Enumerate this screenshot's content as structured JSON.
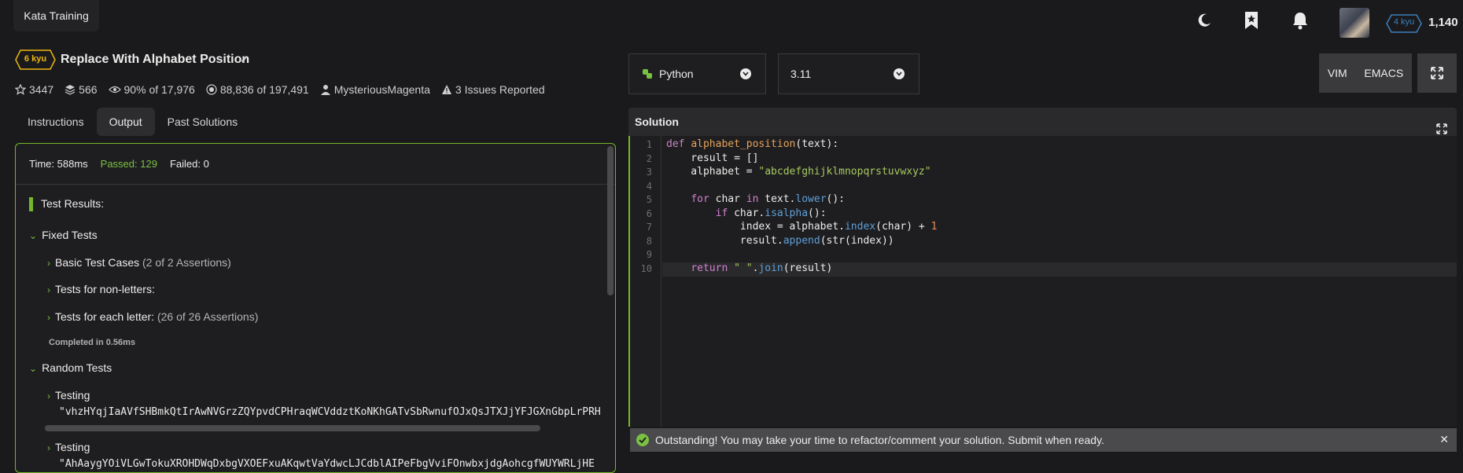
{
  "app": {
    "brand": "Kata Training"
  },
  "user": {
    "rank": "4 kyu",
    "honor": "1,140"
  },
  "colors": {
    "accent_green": "#75b72b",
    "kyu_yellow": "#ecb613",
    "rank_blue": "#3c7ebb"
  },
  "kata": {
    "kyu": "6 kyu",
    "title": "Replace With Alphabet Position",
    "stars": "3447",
    "collections": "566",
    "satisfaction": "90%",
    "satisfaction_of": "of 17,976",
    "completed": "88,836",
    "completed_of": "of 197,491",
    "author": "MysteriousMagenta",
    "issues": "3 Issues Reported"
  },
  "tabs": [
    "Instructions",
    "Output",
    "Past Solutions"
  ],
  "output": {
    "time": "Time: 588ms",
    "passed": "Passed: 129",
    "failed": "Failed: 0",
    "results_title": "Test Results:",
    "fixed_tests": "Fixed Tests",
    "basic_cases": "Basic Test Cases",
    "basic_cases_count": "(2 of 2 Assertions)",
    "non_letters": "Tests for non-letters:",
    "each_letter": "Tests for each letter:",
    "each_letter_count": "(26 of 26 Assertions)",
    "completed_in": "Completed in 0.56ms",
    "random_tests": "Random Tests",
    "testing_label": "Testing",
    "testing_1": "\"vhzHYqjIaAVfSHBmkQtIrAwNVGrzZQYpvdCPHraqWCVddztKoNKhGATvSbRwnufOJxQsJTXJjYFJGXnGbpLrPRH",
    "testing_2": "\"AhAaygYOiVLGwTokuXROHDWqDxbgVXOEFxuAKqwtVaYdwcLJCdblAIPeFbgVviFOnwbxjdgAohcgfWUYWRLjHE"
  },
  "language": {
    "name": "Python",
    "version": "3.11"
  },
  "editor_modes": [
    "VIM",
    "EMACS"
  ],
  "solution": {
    "title": "Solution",
    "line_numbers": [
      "1",
      "2",
      "3",
      "4",
      "5",
      "6",
      "7",
      "8",
      "9",
      "10"
    ]
  },
  "success_message": "Outstanding! You may take your time to refactor/comment your solution. Submit when ready."
}
